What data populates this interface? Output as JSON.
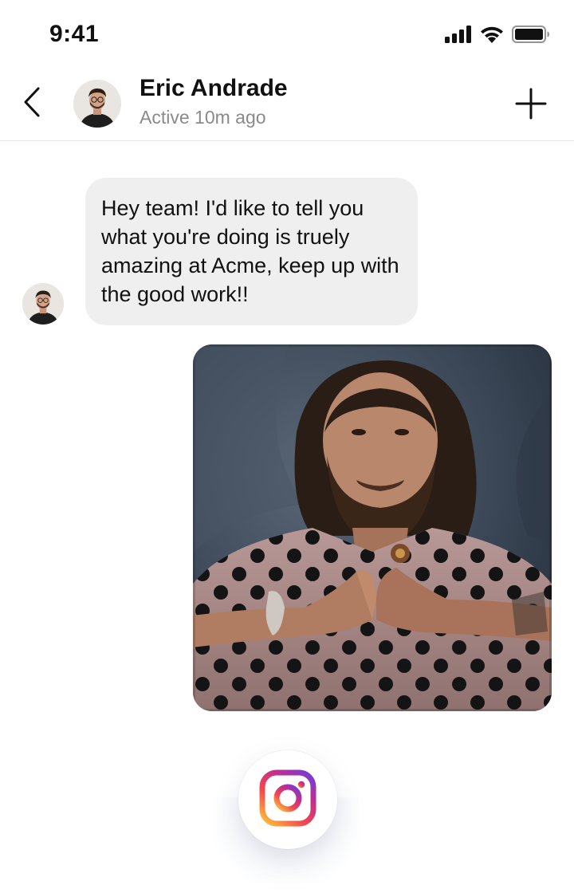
{
  "status_bar": {
    "time": "9:41",
    "icons": [
      "cellular-signal-icon",
      "wifi-icon",
      "battery-icon"
    ]
  },
  "header": {
    "back_icon": "chevron-left-icon",
    "contact_name": "Eric Andrade",
    "contact_status": "Active 10m ago",
    "add_icon": "plus-icon"
  },
  "messages": [
    {
      "type": "text",
      "direction": "incoming",
      "text": "Hey team! I'd like to tell you what you're doing is truely amazing at Acme, keep up with the good work!!"
    },
    {
      "type": "image",
      "direction": "outgoing",
      "image_description": "photo"
    }
  ],
  "floating_button": {
    "icon": "instagram-icon"
  },
  "colors": {
    "bubble_bg": "#efefef",
    "secondary_text": "#8a8a8a",
    "divider": "#e6e6e6",
    "instagram_gradient": [
      "#fdb83b",
      "#f2484f",
      "#c22e8c",
      "#7a3ad4"
    ]
  }
}
